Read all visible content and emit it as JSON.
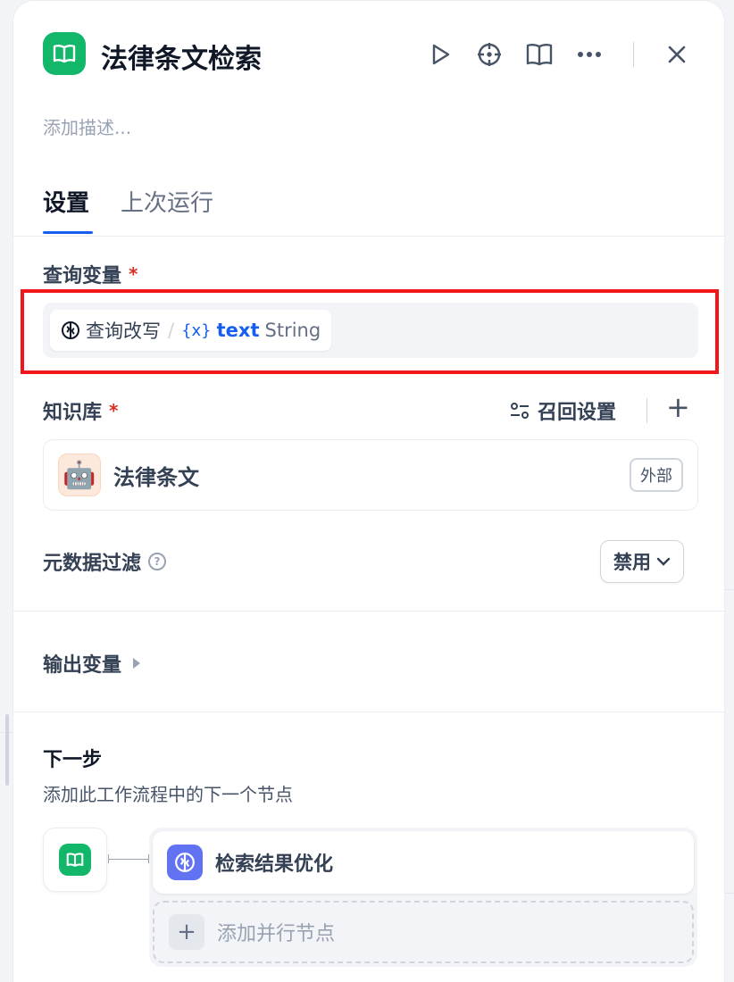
{
  "node": {
    "title": "法律条文检索",
    "description_placeholder": "添加描述..."
  },
  "header_actions": [
    "play-icon",
    "crosshair-icon",
    "book-icon",
    "more-icon",
    "close-icon"
  ],
  "tabs": [
    {
      "label": "设置",
      "active": true
    },
    {
      "label": "上次运行",
      "active": false
    }
  ],
  "query_variable": {
    "label": "查询变量",
    "required_mark": "*",
    "source_node": "查询改写",
    "separator": "/",
    "var_symbol": "{x}",
    "var_name": "text",
    "var_type": "String"
  },
  "knowledge_base": {
    "label": "知识库",
    "required_mark": "*",
    "recall_label": "召回设置",
    "add_symbol": "+",
    "items": [
      {
        "name": "法律条文",
        "badge": "外部",
        "avatar": "🤖"
      }
    ]
  },
  "metadata_filter": {
    "label": "元数据过滤",
    "help_symbol": "?",
    "value": "禁用"
  },
  "output": {
    "label": "输出变量"
  },
  "next_step": {
    "title": "下一步",
    "subtitle": "添加此工作流程中的下一个节点",
    "next_node": "检索结果优化",
    "add_parallel": "添加并行节点",
    "plus_symbol": "+"
  },
  "colors": {
    "node_green": "#12b76a",
    "accent_blue": "#155eef",
    "llm_indigo": "#6172f3",
    "highlight_red": "#f0161a",
    "required_red": "#d92d20"
  }
}
